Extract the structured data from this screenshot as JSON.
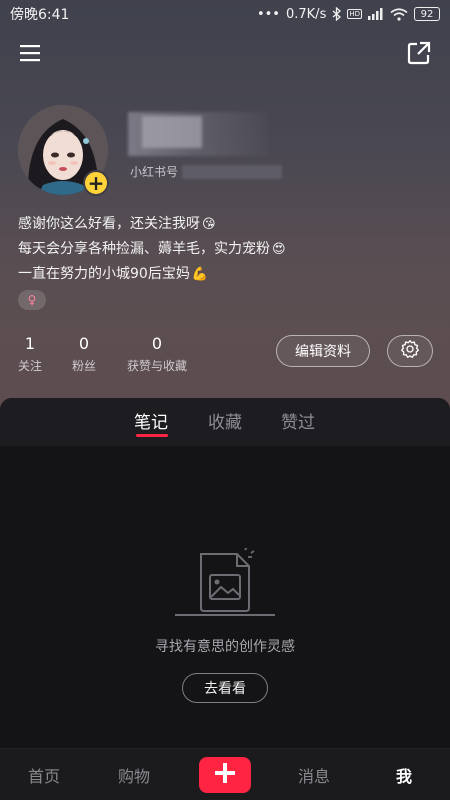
{
  "status_bar": {
    "time": "傍晚6:41",
    "network_speed": "0.7K/s",
    "hd_label": "HD",
    "battery": "92",
    "icons": [
      "dots-icon",
      "bluetooth-icon",
      "hd-icon",
      "signal-icon",
      "wifi-icon",
      "battery-icon"
    ]
  },
  "top_nav": {
    "menu_icon": "menu-icon",
    "share_icon": "share-icon"
  },
  "profile": {
    "id_prefix": "小红书号",
    "bio_lines": [
      {
        "text": "感谢你这么好看，还关注我呀",
        "emoji": "😘"
      },
      {
        "text": "每天会分享各种捡漏、薅羊毛，实力宠粉",
        "emoji": "😍"
      },
      {
        "text": "一直在努力的小城90后宝妈",
        "emoji": "💪"
      }
    ],
    "gender_symbol": "♀",
    "avatar_badge": "+"
  },
  "stats": [
    {
      "num": "1",
      "label": "关注"
    },
    {
      "num": "0",
      "label": "粉丝"
    },
    {
      "num": "0",
      "label": "获赞与收藏"
    }
  ],
  "actions": {
    "edit_label": "编辑资料",
    "settings_icon": "gear-icon"
  },
  "tabs": [
    {
      "label": "笔记",
      "active": true
    },
    {
      "label": "收藏",
      "active": false
    },
    {
      "label": "赞过",
      "active": false
    }
  ],
  "empty_state": {
    "text": "寻找有意思的创作灵感",
    "button": "去看看",
    "icon": "empty-note-icon"
  },
  "bottom_nav": {
    "items": [
      {
        "label": "首页",
        "active": false
      },
      {
        "label": "购物",
        "active": false
      },
      {
        "label": "消息",
        "active": false
      },
      {
        "label": "我",
        "active": true
      }
    ],
    "plus_icon": "plus-icon"
  },
  "colors": {
    "accent": "#ff2442",
    "badge": "#ffd23a"
  }
}
